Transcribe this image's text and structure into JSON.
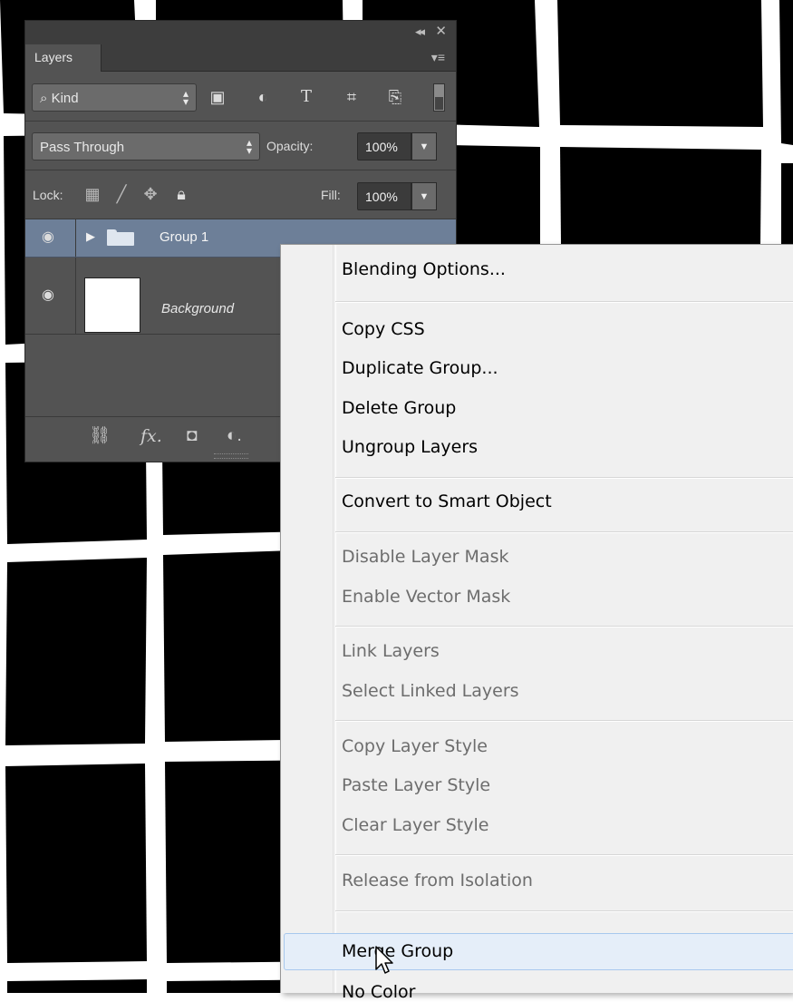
{
  "layers_panel": {
    "tab_label": "Layers",
    "kind_filter": "Kind",
    "blend_mode": "Pass Through",
    "opacity_label": "Opacity:",
    "opacity_value": "100%",
    "lock_label": "Lock:",
    "fill_label": "Fill:",
    "fill_value": "100%",
    "layers": [
      {
        "name": "Group 1",
        "type": "group",
        "visible": true,
        "selected": true
      },
      {
        "name": "Background",
        "type": "pixel",
        "visible": true,
        "selected": false
      }
    ]
  },
  "context_menu": {
    "items": [
      {
        "label": "Blending Options...",
        "enabled": true
      },
      {
        "label": "Copy CSS",
        "enabled": true
      },
      {
        "label": "Duplicate Group...",
        "enabled": true
      },
      {
        "label": "Delete Group",
        "enabled": true
      },
      {
        "label": "Ungroup Layers",
        "enabled": true
      },
      {
        "label": "Convert to Smart Object",
        "enabled": true
      },
      {
        "label": "Disable Layer Mask",
        "enabled": false
      },
      {
        "label": "Enable Vector Mask",
        "enabled": false
      },
      {
        "label": "Link Layers",
        "enabled": false
      },
      {
        "label": "Select Linked Layers",
        "enabled": false
      },
      {
        "label": "Copy Layer Style",
        "enabled": false
      },
      {
        "label": "Paste Layer Style",
        "enabled": false
      },
      {
        "label": "Clear Layer Style",
        "enabled": false
      },
      {
        "label": "Release from Isolation",
        "enabled": false
      },
      {
        "label": "Merge Group",
        "enabled": true,
        "hovered": true
      },
      {
        "label": "No Color",
        "enabled": true
      }
    ]
  },
  "colors": {
    "panel_bg": "#535353",
    "selected_layer": "#6d7f98",
    "menu_bg": "#f0f0f0",
    "menu_hover": "#e5eef9",
    "canvas_black": "#000000",
    "canvas_white": "#ffffff"
  }
}
